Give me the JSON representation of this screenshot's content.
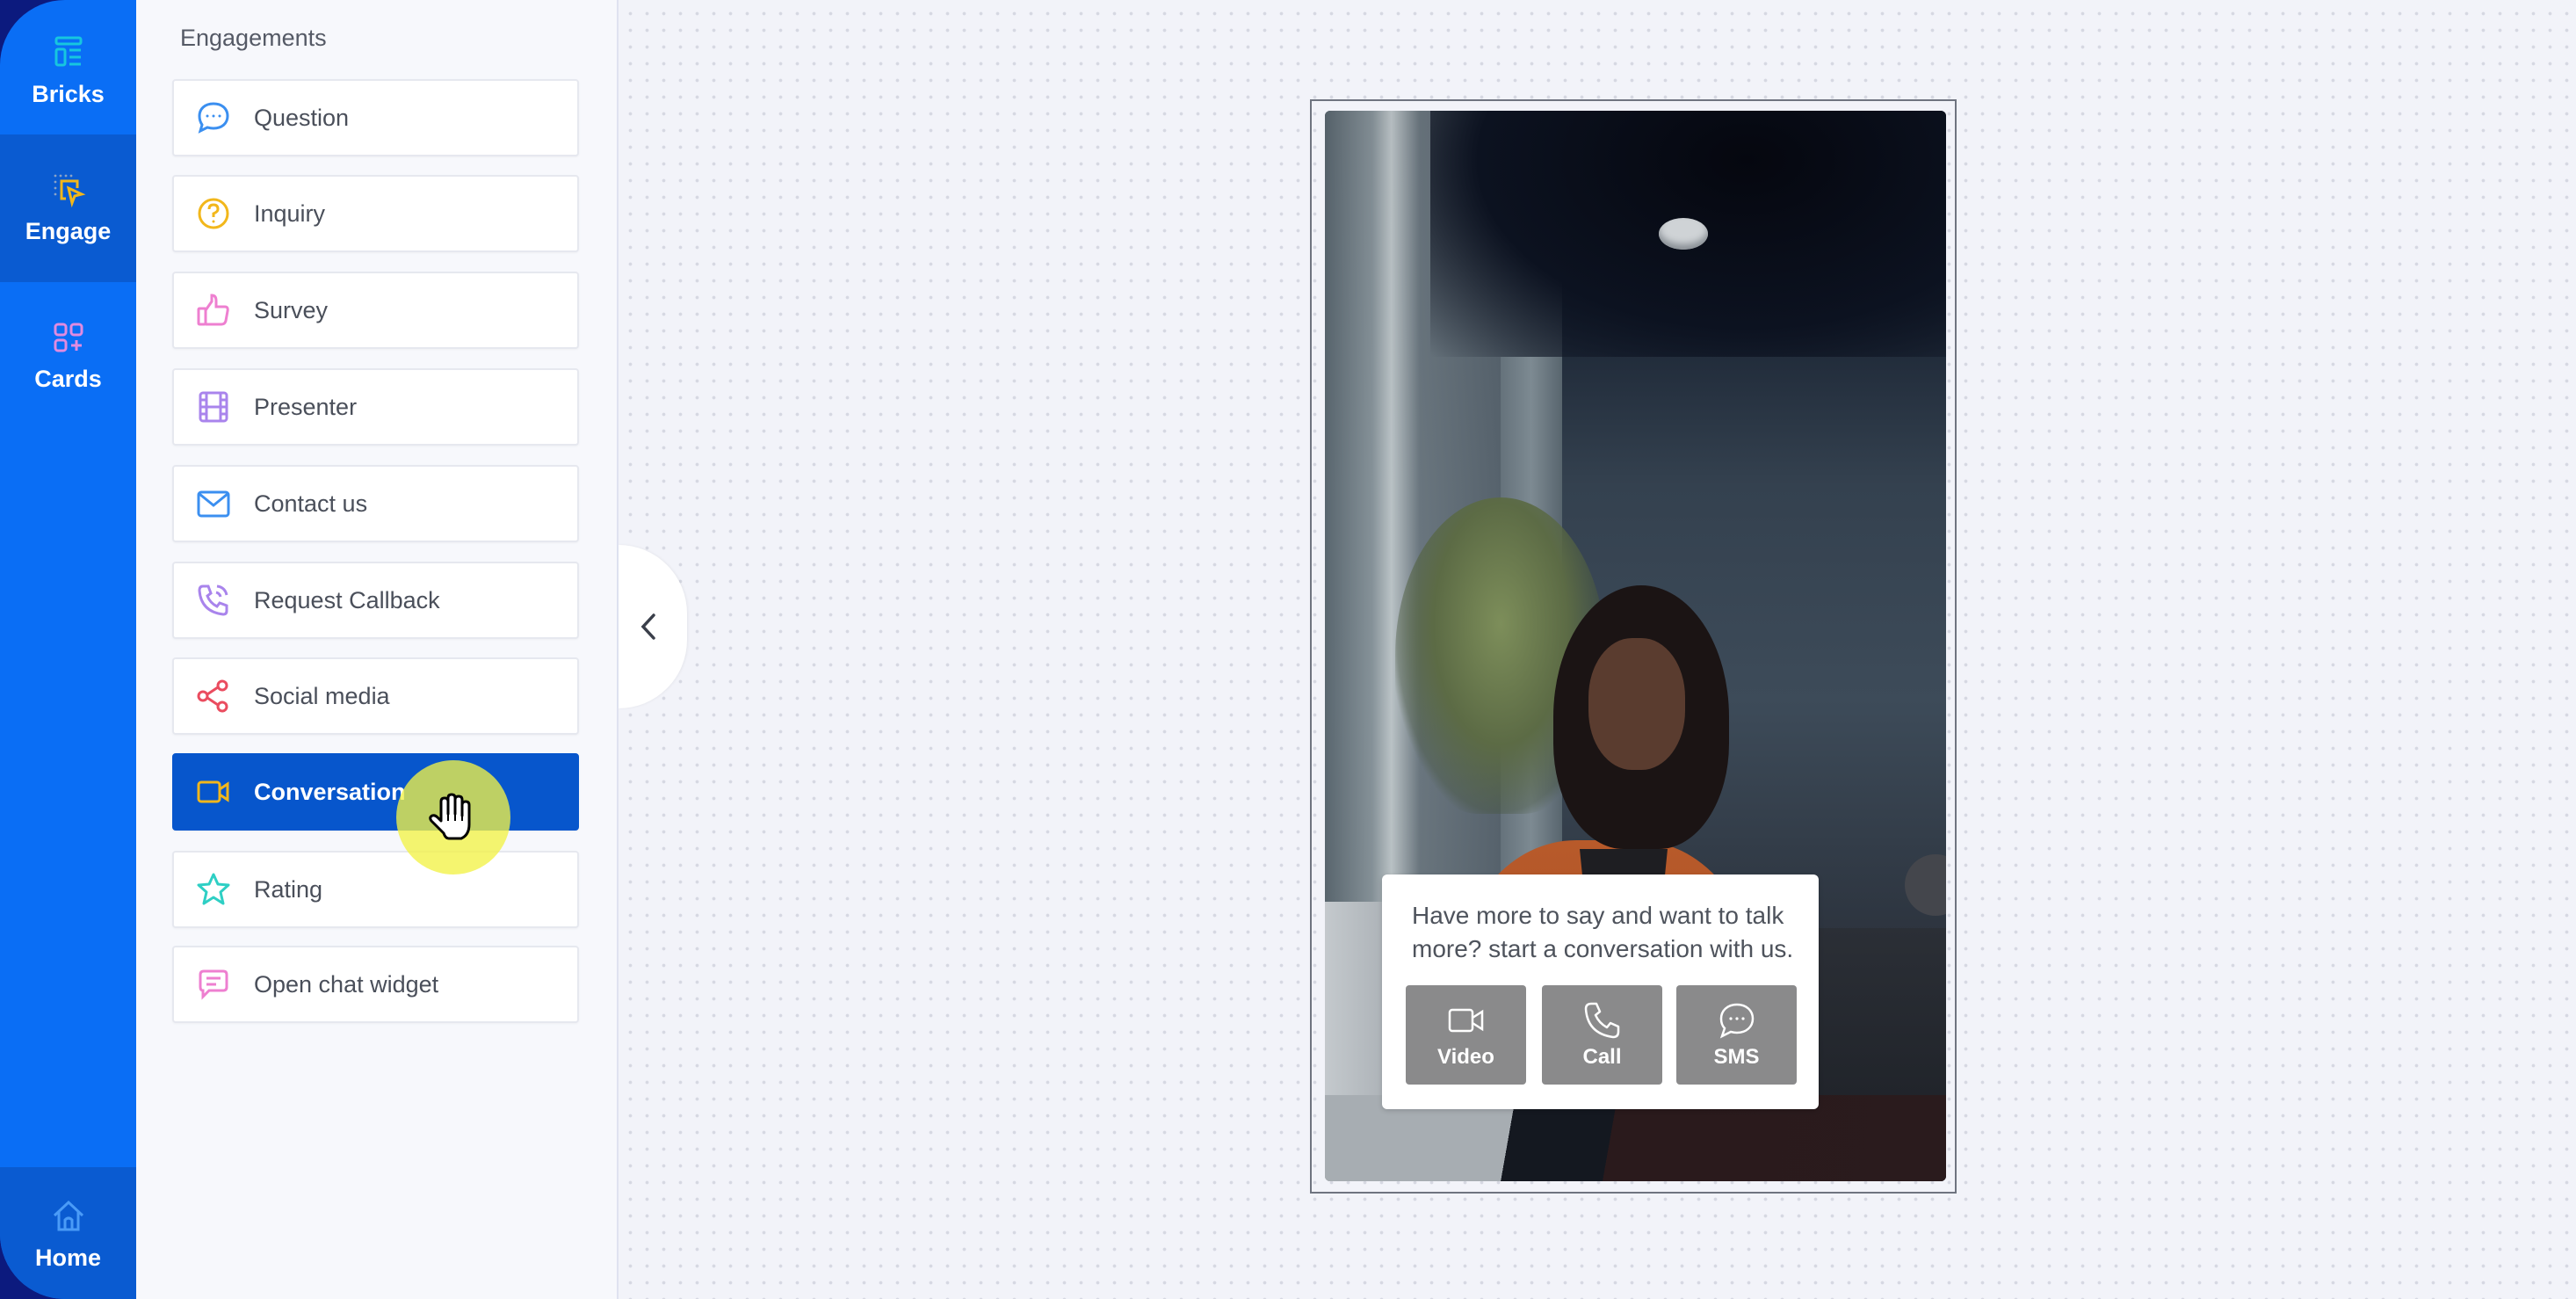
{
  "rail": {
    "items": [
      {
        "label": "Bricks",
        "icon": "bricks-icon",
        "selected": false,
        "icon_color": "#17c6df"
      },
      {
        "label": "Engage",
        "icon": "engage-icon",
        "selected": true,
        "icon_color": "#f2b71b"
      },
      {
        "label": "Cards",
        "icon": "cards-icon",
        "selected": false,
        "icon_color": "#e08be0"
      }
    ],
    "home": {
      "label": "Home",
      "icon": "home-icon",
      "icon_color": "#4a9bf7"
    }
  },
  "panel": {
    "title": "Engagements",
    "items": [
      {
        "label": "Question",
        "icon": "chat-bubble-icon",
        "icon_color": "#3b8ff0",
        "selected": false
      },
      {
        "label": "Inquiry",
        "icon": "question-circle-icon",
        "icon_color": "#f2b71b",
        "selected": false
      },
      {
        "label": "Survey",
        "icon": "thumbs-up-icon",
        "icon_color": "#ee7fd0",
        "selected": false
      },
      {
        "label": "Presenter",
        "icon": "film-icon",
        "icon_color": "#a984ec",
        "selected": false
      },
      {
        "label": "Contact us",
        "icon": "mail-icon",
        "icon_color": "#3b8ff0",
        "selected": false
      },
      {
        "label": "Request Callback",
        "icon": "phone-callback-icon",
        "icon_color": "#a984ec",
        "selected": false
      },
      {
        "label": "Social media",
        "icon": "share-icon",
        "icon_color": "#ea4c5f",
        "selected": false
      },
      {
        "label": "Conversation",
        "icon": "video-camera-icon",
        "icon_color": "#f2b71b",
        "selected": true
      },
      {
        "label": "Rating",
        "icon": "star-icon",
        "icon_color": "#2ecfc4",
        "selected": false
      },
      {
        "label": "Open chat widget",
        "icon": "chat-lines-icon",
        "icon_color": "#ee7fd0",
        "selected": false
      }
    ]
  },
  "preview": {
    "card_text": "Have more to say and want to talk more? start a conversation with us.",
    "buttons": [
      {
        "label": "Video",
        "icon": "video-camera-icon"
      },
      {
        "label": "Call",
        "icon": "phone-icon"
      },
      {
        "label": "SMS",
        "icon": "chat-bubble-icon"
      }
    ]
  },
  "colors": {
    "rail_bg": "#0a6ef5",
    "rail_selected": "#0a5bd1",
    "selected_item_bg": "#0756cc",
    "cta_button_bg": "#8a8a8b"
  }
}
